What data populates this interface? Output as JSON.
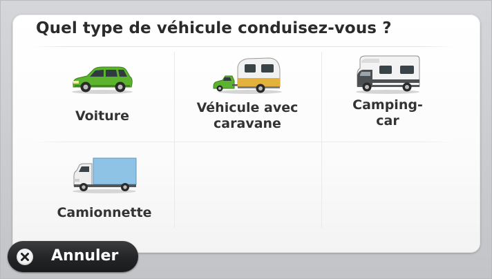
{
  "dialog": {
    "title": "Quel type de véhicule conduisez-vous ?"
  },
  "vehicle_options": [
    {
      "label": "Voiture",
      "icon": "car-icon"
    },
    {
      "label": "Véhicule avec\ncaravane",
      "icon": "car-with-caravan-icon"
    },
    {
      "label": "Camping-\ncar",
      "icon": "camper-van-icon"
    },
    {
      "label": "Camionnette",
      "icon": "van-icon"
    }
  ],
  "cancel_button": {
    "label": "Annuler",
    "icon": "close-icon"
  },
  "colors": {
    "car_body": "#5bb32e",
    "caravan_stripe": "#e3b23c",
    "van_box": "#8ec3e6",
    "camper_body": "#f2f2f2",
    "button_dark": "#232425"
  }
}
